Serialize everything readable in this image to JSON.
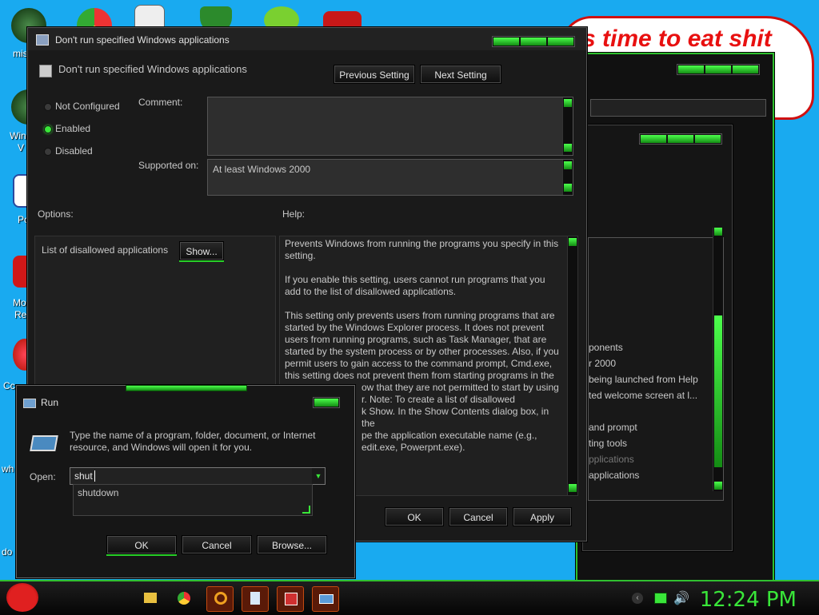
{
  "desktop": {
    "icons": [
      {
        "label": "mis"
      },
      {
        "label": "Win"
      },
      {
        "label": "V"
      },
      {
        "label": "Po"
      },
      {
        "label": "Mo"
      },
      {
        "label": "Re"
      },
      {
        "label": "Cc"
      },
      {
        "label": "wh"
      },
      {
        "label": "do"
      }
    ],
    "bubble_text": "s time to eat shit"
  },
  "back_window": {
    "list_items": [
      "ponents",
      "r 2000",
      "being launched from Help",
      "ted welcome screen at l...",
      "and prompt",
      "ting tools",
      "pplications",
      "applications"
    ]
  },
  "policy_window": {
    "title": "Don't run specified Windows applications",
    "heading": "Don't run specified Windows applications",
    "prev_button": "Previous Setting",
    "next_button": "Next Setting",
    "radio_not_configured": "Not Configured",
    "radio_enabled": "Enabled",
    "radio_disabled": "Disabled",
    "comment_label": "Comment:",
    "supported_label": "Supported on:",
    "supported_value": "At least Windows 2000",
    "options_label": "Options:",
    "help_label": "Help:",
    "option_list_label": "List of disallowed applications",
    "show_button": "Show...",
    "help_paragraphs": [
      "Prevents Windows from running the programs you specify in this setting.",
      "If you enable this setting, users cannot run programs that you add to the list of disallowed applications.",
      "This setting only prevents users from running programs that are started by the Windows Explorer process. It does not prevent users from running programs, such as Task Manager, that are started by the system process or by other processes. Also, if you permit users to gain access to the command prompt, Cmd.exe, this setting does not prevent them from starting programs in the",
      "ow that they are not permitted to start by using",
      "r. Note: To create a list of disallowed",
      "k Show. In the Show Contents dialog box, in the",
      "pe the application executable name (e.g.,",
      "edit.exe, Powerpnt.exe)."
    ],
    "ok_button": "OK",
    "cancel_button": "Cancel",
    "apply_button": "Apply"
  },
  "run_dialog": {
    "title": "Run",
    "description": "Type the name of a program, folder, document, or Internet resource, and Windows will open it for you.",
    "open_label": "Open:",
    "input_value": "shut",
    "suggestion": "shutdown",
    "ok_button": "OK",
    "cancel_button": "Cancel",
    "browse_button": "Browse..."
  },
  "taskbar": {
    "clock": "12:24 PM"
  },
  "colors": {
    "accent_green": "#39e639",
    "desktop_blue": "#19aaf0",
    "window_dark": "#1a1a1a"
  }
}
